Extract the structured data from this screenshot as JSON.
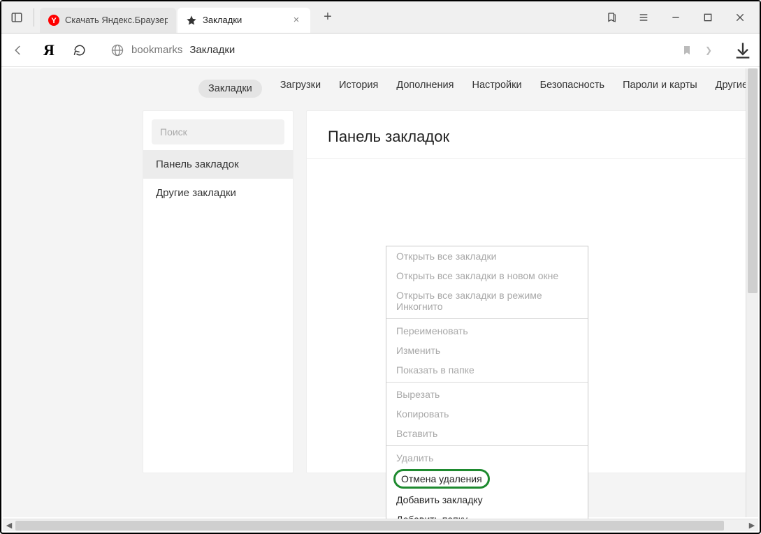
{
  "tabs": [
    {
      "title": "Скачать Яндекс.Браузер д",
      "favicon": "yandex"
    },
    {
      "title": "Закладки",
      "favicon": "star",
      "active": true
    }
  ],
  "window": {
    "panel_icon": "panel-icon",
    "bookmark_all_icon": "bookmark-open-icon",
    "menu_icon": "hamburger-icon"
  },
  "toolbar": {
    "back_disabled": true,
    "yandex_logo": "Я",
    "address": {
      "scheme": "bookmarks",
      "label": "Закладки"
    }
  },
  "nav": {
    "items": [
      "Закладки",
      "Загрузки",
      "История",
      "Дополнения",
      "Настройки",
      "Безопасность",
      "Пароли и карты",
      "Другие устройства"
    ],
    "active_index": 0
  },
  "sidebar": {
    "search_placeholder": "Поиск",
    "items": [
      "Панель закладок",
      "Другие закладки"
    ],
    "active_index": 0
  },
  "main": {
    "heading": "Панель закладок"
  },
  "ctx": {
    "groups": [
      [
        "Открыть все закладки",
        "Открыть все закладки в новом окне",
        "Открыть все закладки в режиме Инкогнито"
      ],
      [
        "Переименовать",
        "Изменить",
        "Показать в папке"
      ],
      [
        "Вырезать",
        "Копировать",
        "Вставить"
      ],
      [
        "Удалить"
      ]
    ],
    "highlight": "Отмена удаления",
    "tail": [
      "Добавить закладку",
      "Добавить папку"
    ]
  }
}
